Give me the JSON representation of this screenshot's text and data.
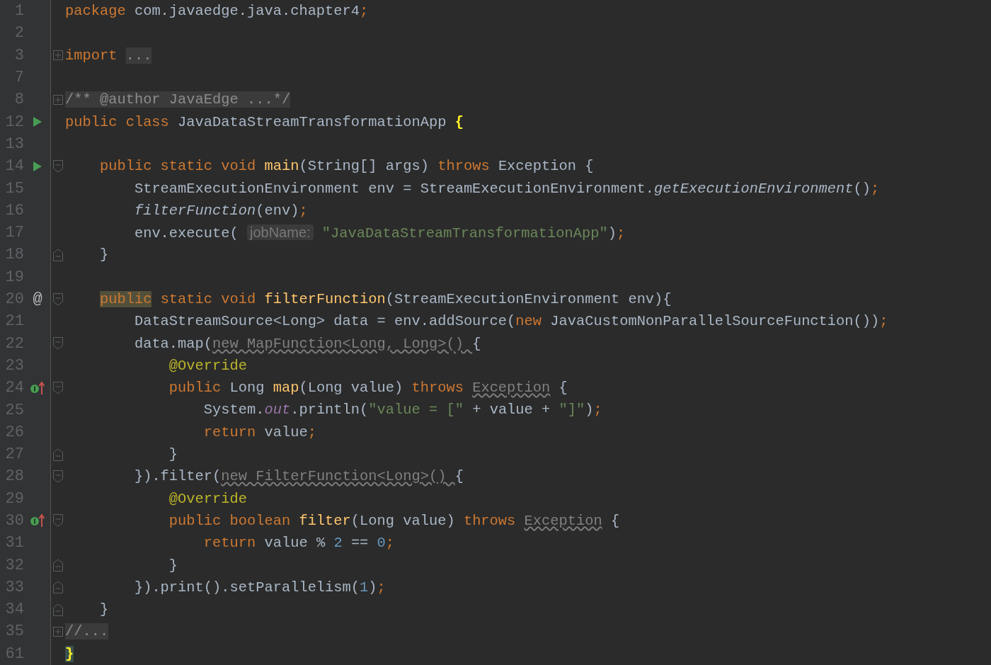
{
  "editor": {
    "lines": [
      {
        "number": "1",
        "tokens": [
          {
            "kind": "kw",
            "text": "package"
          },
          {
            "kind": "plain",
            "text": " com.javaedge.java.chapter4"
          },
          {
            "kind": "kw",
            "text": ";"
          }
        ]
      },
      {
        "number": "2"
      },
      {
        "number": "3",
        "fold": {
          "kind": "expand"
        },
        "tokens": [
          {
            "kind": "kw",
            "text": "import "
          },
          {
            "kind": "folded",
            "text": "..."
          }
        ]
      },
      {
        "number": "7"
      },
      {
        "number": "8",
        "fold": {
          "kind": "expand"
        },
        "tokens": [
          {
            "kind": "folded",
            "text": "/** @author JavaEdge ...*/"
          }
        ]
      },
      {
        "number": "12",
        "gutter": {
          "kind": "run"
        },
        "tokens": [
          {
            "kind": "kw",
            "text": "public class"
          },
          {
            "kind": "plain",
            "text": " JavaDataStreamTransformationApp "
          },
          {
            "kind": "brace",
            "text": "{"
          }
        ]
      },
      {
        "number": "13"
      },
      {
        "number": "14",
        "gutter": {
          "kind": "run"
        },
        "fold": {
          "kind": "start"
        },
        "tokens": [
          {
            "kind": "kw",
            "text": "    public static void "
          },
          {
            "kind": "fn",
            "text": "main"
          },
          {
            "kind": "plain",
            "text": "(String[] args) "
          },
          {
            "kind": "kw",
            "text": "throws"
          },
          {
            "kind": "plain",
            "text": " Exception {"
          }
        ]
      },
      {
        "number": "15",
        "tokens": [
          {
            "kind": "plain",
            "text": "        StreamExecutionEnvironment env = StreamExecutionEnvironment."
          },
          {
            "kind": "ital",
            "text": "getExecutionEnvironment"
          },
          {
            "kind": "plain",
            "text": "()"
          },
          {
            "kind": "kw",
            "text": ";"
          }
        ]
      },
      {
        "number": "16",
        "tokens": [
          {
            "kind": "ital",
            "text": "        filterFunction"
          },
          {
            "kind": "plain",
            "text": "(env)"
          },
          {
            "kind": "kw",
            "text": ";"
          }
        ]
      },
      {
        "number": "17",
        "tokens": [
          {
            "kind": "plain",
            "text": "        env.execute( "
          },
          {
            "kind": "hint",
            "text": "jobName:"
          },
          {
            "kind": "str",
            "text": " \"JavaDataStreamTransformationApp\""
          },
          {
            "kind": "plain",
            "text": ")"
          },
          {
            "kind": "kw",
            "text": ";"
          }
        ]
      },
      {
        "number": "18",
        "fold": {
          "kind": "end"
        },
        "tokens": [
          {
            "kind": "plain",
            "text": "    }"
          }
        ]
      },
      {
        "number": "19"
      },
      {
        "number": "20",
        "gutter": {
          "kind": "symbol",
          "text": "@"
        },
        "fold": {
          "kind": "start"
        },
        "tokens": [
          {
            "kind": "kwhl",
            "text": "    public"
          },
          {
            "kind": "kw",
            "text": " static void "
          },
          {
            "kind": "fn",
            "text": "filterFunction"
          },
          {
            "kind": "plain",
            "text": "(StreamExecutionEnvironment env){"
          }
        ]
      },
      {
        "number": "21",
        "tokens": [
          {
            "kind": "plain",
            "text": "        DataStreamSource<Long> data = env.addSource("
          },
          {
            "kind": "kw",
            "text": "new"
          },
          {
            "kind": "plain",
            "text": " JavaCustomNonParallelSourceFunction())"
          },
          {
            "kind": "kw",
            "text": ";"
          }
        ]
      },
      {
        "number": "22",
        "fold": {
          "kind": "start"
        },
        "tokens": [
          {
            "kind": "plain",
            "text": "        data.map("
          },
          {
            "kind": "warn",
            "text": "new MapFunction<Long, Long>() "
          },
          {
            "kind": "plain",
            "text": "{"
          }
        ]
      },
      {
        "number": "23",
        "tokens": [
          {
            "kind": "ann",
            "text": "            @Override"
          }
        ]
      },
      {
        "number": "24",
        "gutter": {
          "kind": "implements"
        },
        "fold": {
          "kind": "start"
        },
        "tokens": [
          {
            "kind": "kw",
            "text": "            public"
          },
          {
            "kind": "plain",
            "text": " Long "
          },
          {
            "kind": "fn",
            "text": "map"
          },
          {
            "kind": "plain",
            "text": "(Long value) "
          },
          {
            "kind": "kw",
            "text": "throws "
          },
          {
            "kind": "warn",
            "text": "Exception"
          },
          {
            "kind": "plain",
            "text": " {"
          }
        ]
      },
      {
        "number": "25",
        "tokens": [
          {
            "kind": "plain",
            "text": "                System."
          },
          {
            "kind": "field",
            "text": "out"
          },
          {
            "kind": "plain",
            "text": ".println("
          },
          {
            "kind": "str",
            "text": "\"value = [\""
          },
          {
            "kind": "plain",
            "text": " + value + "
          },
          {
            "kind": "str",
            "text": "\"]\""
          },
          {
            "kind": "plain",
            "text": ")"
          },
          {
            "kind": "kw",
            "text": ";"
          }
        ]
      },
      {
        "number": "26",
        "tokens": [
          {
            "kind": "kw",
            "text": "                return"
          },
          {
            "kind": "plain",
            "text": " value"
          },
          {
            "kind": "kw",
            "text": ";"
          }
        ]
      },
      {
        "number": "27",
        "fold": {
          "kind": "end"
        },
        "tokens": [
          {
            "kind": "plain",
            "text": "            }"
          }
        ]
      },
      {
        "number": "28",
        "fold": {
          "kind": "start"
        },
        "tokens": [
          {
            "kind": "plain",
            "text": "        }).filter("
          },
          {
            "kind": "warn",
            "text": "new FilterFunction<Long>() "
          },
          {
            "kind": "plain",
            "text": "{"
          }
        ]
      },
      {
        "number": "29",
        "tokens": [
          {
            "kind": "ann",
            "text": "            @Override"
          }
        ]
      },
      {
        "number": "30",
        "gutter": {
          "kind": "implements"
        },
        "fold": {
          "kind": "start"
        },
        "tokens": [
          {
            "kind": "kw",
            "text": "            public boolean "
          },
          {
            "kind": "fn",
            "text": "filter"
          },
          {
            "kind": "plain",
            "text": "(Long value) "
          },
          {
            "kind": "kw",
            "text": "throws "
          },
          {
            "kind": "warn",
            "text": "Exception"
          },
          {
            "kind": "plain",
            "text": " {"
          }
        ]
      },
      {
        "number": "31",
        "tokens": [
          {
            "kind": "kw",
            "text": "                return"
          },
          {
            "kind": "plain",
            "text": " value % "
          },
          {
            "kind": "num",
            "text": "2"
          },
          {
            "kind": "plain",
            "text": " == "
          },
          {
            "kind": "num",
            "text": "0"
          },
          {
            "kind": "kw",
            "text": ";"
          }
        ]
      },
      {
        "number": "32",
        "fold": {
          "kind": "end"
        },
        "tokens": [
          {
            "kind": "plain",
            "text": "            }"
          }
        ]
      },
      {
        "number": "33",
        "fold": {
          "kind": "end"
        },
        "tokens": [
          {
            "kind": "plain",
            "text": "        }).print().setParallelism("
          },
          {
            "kind": "num",
            "text": "1"
          },
          {
            "kind": "plain",
            "text": ")"
          },
          {
            "kind": "kw",
            "text": ";"
          }
        ]
      },
      {
        "number": "34",
        "fold": {
          "kind": "end"
        },
        "tokens": [
          {
            "kind": "plain",
            "text": "    }"
          }
        ]
      },
      {
        "number": "35",
        "fold": {
          "kind": "expand"
        },
        "tokens": [
          {
            "kind": "folded",
            "text": "//..."
          }
        ]
      },
      {
        "number": "61",
        "tokens": [
          {
            "kind": "bracehl",
            "text": "}"
          }
        ]
      }
    ]
  }
}
